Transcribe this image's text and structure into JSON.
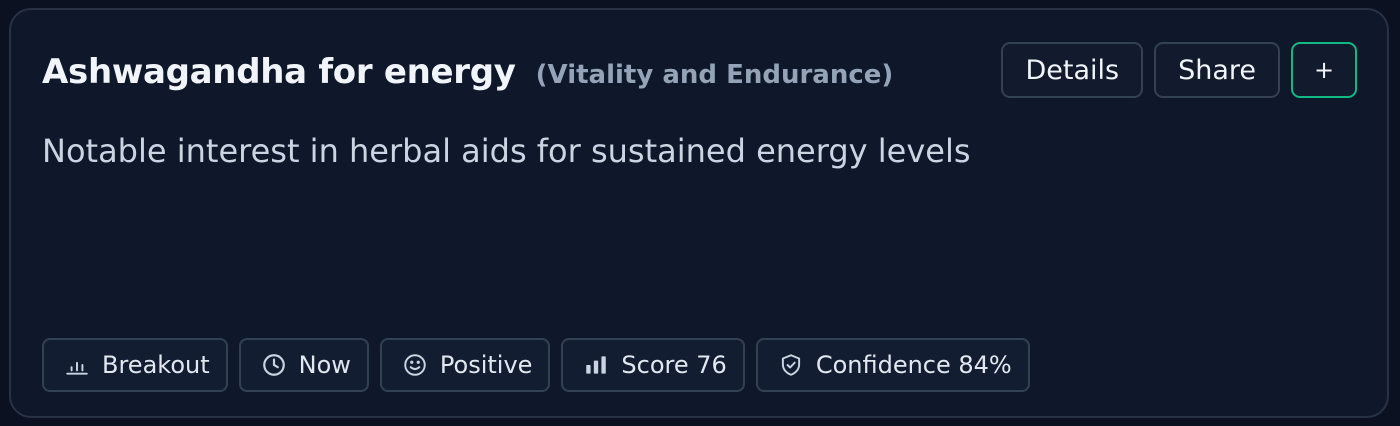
{
  "card": {
    "title": "Ashwagandha for energy",
    "category": "(Vitality and Endurance)",
    "description": "Notable interest in herbal aids for sustained energy levels"
  },
  "actions": {
    "details_label": "Details",
    "share_label": "Share",
    "add_label": "+"
  },
  "tags": [
    {
      "label": "Breakout",
      "icon": "bar-chart-icon"
    },
    {
      "label": "Now",
      "icon": "clock-icon"
    },
    {
      "label": "Positive",
      "icon": "smiley-icon"
    },
    {
      "label": "Score 76",
      "icon": "signal-bars-icon"
    },
    {
      "label": "Confidence 84%",
      "icon": "shield-check-icon"
    }
  ],
  "colors": {
    "background": "#0b1120",
    "card": "#0f172a",
    "border": "#273244",
    "accent": "#10b981",
    "text_primary": "#f1f5f9",
    "text_muted": "#94a3b8"
  }
}
